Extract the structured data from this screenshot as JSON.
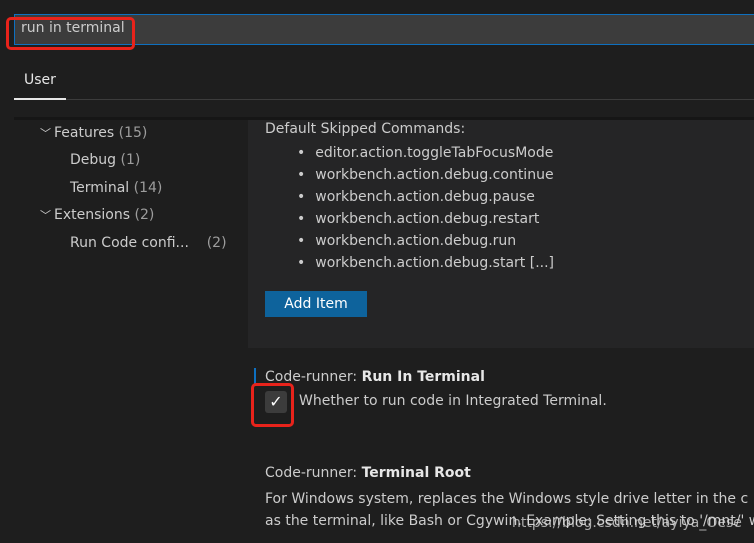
{
  "search": {
    "value": "run in terminal"
  },
  "tabs": [
    {
      "label": "User",
      "active": true
    }
  ],
  "toc": [
    {
      "label": "Features",
      "count": "(15)",
      "expanded": true
    },
    {
      "label": "Debug",
      "count": "(1)"
    },
    {
      "label": "Terminal",
      "count": "(14)"
    },
    {
      "label": "Extensions",
      "count": "(2)",
      "expanded": true
    },
    {
      "label": "Run Code confi...",
      "count": "(2)"
    }
  ],
  "skipped": {
    "label": "Default Skipped Commands:",
    "items": [
      "editor.action.toggleTabFocusMode",
      "workbench.action.debug.continue",
      "workbench.action.debug.pause",
      "workbench.action.debug.restart",
      "workbench.action.debug.run",
      "workbench.action.debug.start [...]"
    ],
    "add_item": "Add Item"
  },
  "run_in_terminal": {
    "prefix": "Code-runner: ",
    "name": "Run In Terminal",
    "description": "Whether to run code in Integrated Terminal.",
    "checked": true,
    "check": "✓"
  },
  "terminal_root": {
    "prefix": "Code-runner: ",
    "name": "Terminal Root",
    "line1": "For Windows system, replaces the Windows style drive letter in the c",
    "line2": "as the terminal, like Bash or Cgywin. Example: Setting this to '/mnt/' w"
  },
  "watermark": "https://blog.csdn.net/ayiya_Oese",
  "colors": {
    "accent": "#0e70c0",
    "button": "#0e639c",
    "highlight": "#e8231b"
  }
}
